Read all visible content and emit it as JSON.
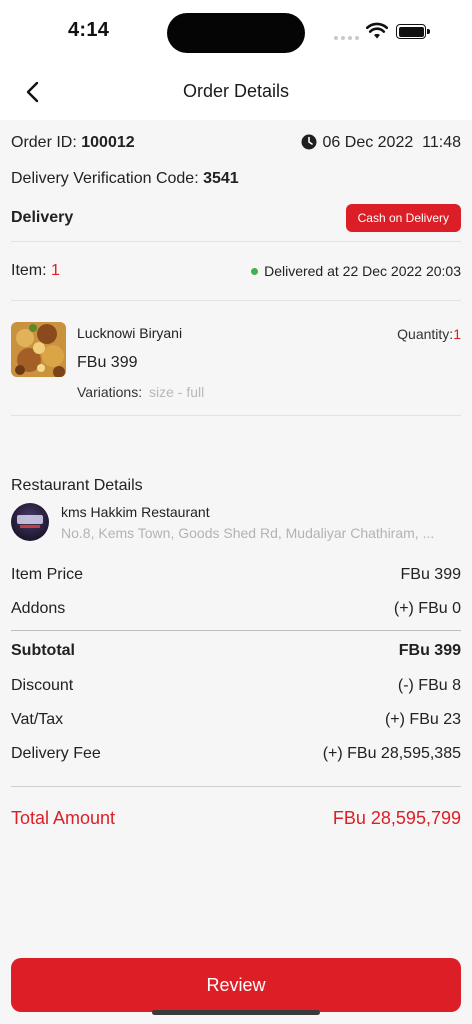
{
  "status_bar": {
    "time": "4:14"
  },
  "header": {
    "title": "Order Details"
  },
  "order": {
    "id_label": "Order ID:",
    "id_value": "100012",
    "date": "06 Dec 2022",
    "time": "11:48",
    "verification_label": "Delivery Verification Code:",
    "verification_code": "3541",
    "delivery_label": "Delivery",
    "payment_badge": "Cash on Delivery",
    "item_label": "Item:",
    "item_count": "1",
    "delivered_text": "Delivered at 22 Dec 2022  20:03"
  },
  "product": {
    "name": "Lucknowi Biryani",
    "price": "FBu 399",
    "variations_label": "Variations:",
    "variations_value": "size - full",
    "quantity_label": "Quantity:",
    "quantity_value": "1"
  },
  "restaurant": {
    "section_title": "Restaurant Details",
    "name": "kms Hakkim Restaurant",
    "address": "No.8, Kems Town, Goods Shed Rd, Mudaliyar Chathiram, ..."
  },
  "summary": {
    "item_price_label": "Item Price",
    "item_price_value": "FBu 399",
    "addons_label": "Addons",
    "addons_value": "(+) FBu 0",
    "subtotal_label": "Subtotal",
    "subtotal_value": "FBu 399",
    "discount_label": "Discount",
    "discount_value": "(-) FBu 8",
    "vat_label": "Vat/Tax",
    "vat_value": "(+) FBu 23",
    "delivery_fee_label": "Delivery Fee",
    "delivery_fee_value": "(+) FBu 28,595,385",
    "total_label": "Total Amount",
    "total_value": "FBu 28,595,799"
  },
  "actions": {
    "review_label": "Review"
  },
  "colors": {
    "accent": "#dc1f26",
    "status_green": "#3bb54a",
    "muted_text": "#b3b3b3"
  },
  "icons": [
    "back-arrow-icon",
    "clock-icon",
    "wifi-icon",
    "battery-icon",
    "status-dot-icon"
  ]
}
